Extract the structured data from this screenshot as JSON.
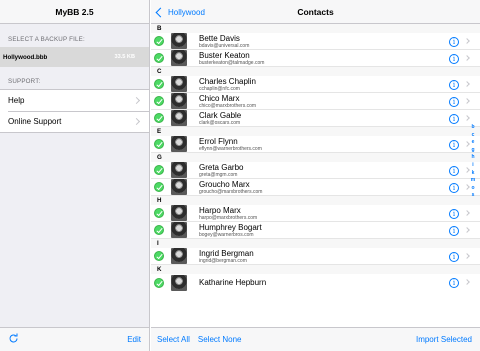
{
  "left": {
    "title": "MyBB 2.5",
    "select_header": "SELECT A BACKUP FILE:",
    "backup": {
      "name": "Hollywood.bbb",
      "size": "33.5 KB"
    },
    "support_header": "SUPPORT:",
    "menu": [
      {
        "label": "Help"
      },
      {
        "label": "Online Support"
      }
    ],
    "toolbar": {
      "refresh_icon": "refresh-icon",
      "edit": "Edit"
    }
  },
  "right": {
    "back_label": "Hollywood",
    "title": "Contacts",
    "sections": [
      {
        "letter": "B",
        "contacts": [
          {
            "name": "Bette Davis",
            "email": "bdavis@universal.com"
          },
          {
            "name": "Buster Keaton",
            "email": "busterkeaton@talmadge.com"
          }
        ]
      },
      {
        "letter": "C",
        "contacts": [
          {
            "name": "Charles Chaplin",
            "email": "cchaplin@nfc.com"
          },
          {
            "name": "Chico Marx",
            "email": "chico@marxbrothers.com"
          },
          {
            "name": "Clark Gable",
            "email": "clark@oscars.com"
          }
        ]
      },
      {
        "letter": "E",
        "contacts": [
          {
            "name": "Errol Flynn",
            "email": "eflynn@warnerbrothers.com"
          }
        ]
      },
      {
        "letter": "G",
        "contacts": [
          {
            "name": "Greta Garbo",
            "email": "greta@mgm.com"
          },
          {
            "name": "Groucho Marx",
            "email": "groucho@marxbrothers.com"
          }
        ]
      },
      {
        "letter": "H",
        "contacts": [
          {
            "name": "Harpo Marx",
            "email": "harpo@marxbrothers.com"
          },
          {
            "name": "Humphrey Bogart",
            "email": "bogey@warnerbros.com"
          }
        ]
      },
      {
        "letter": "I",
        "contacts": [
          {
            "name": "Ingrid Bergman",
            "email": "ingrid@bergman.com"
          }
        ]
      },
      {
        "letter": "K",
        "contacts": [
          {
            "name": "Katharine Hepburn",
            "email": ""
          }
        ]
      }
    ],
    "index_letters": [
      "b",
      "c",
      "e",
      "g",
      "h",
      "i",
      "k",
      "m",
      "o",
      "s"
    ],
    "toolbar": {
      "select_all": "Select All",
      "select_none": "Select None",
      "import": "Import Selected"
    },
    "colors": {
      "accent": "#007aff",
      "check": "#4cd964"
    }
  }
}
